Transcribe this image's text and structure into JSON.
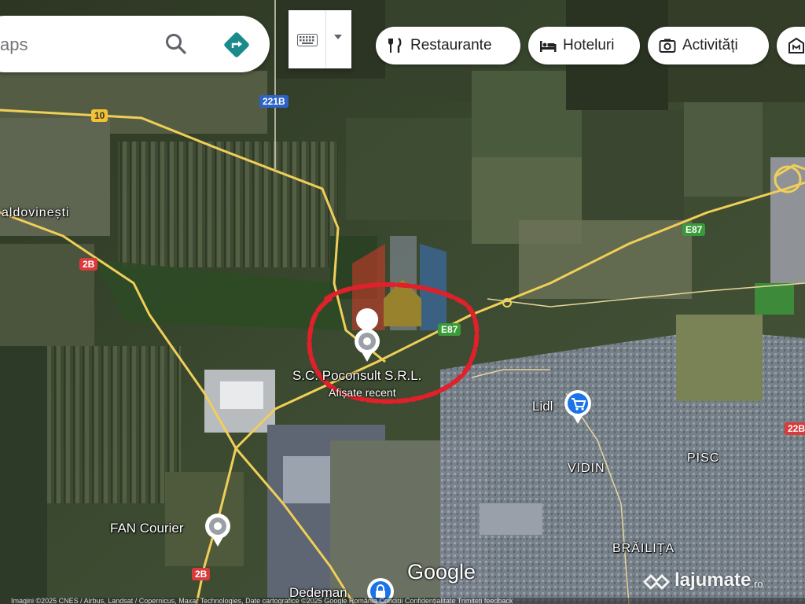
{
  "search": {
    "placeholder": "aps",
    "search_icon": "search-icon",
    "directions_icon": "directions-icon"
  },
  "input_tools": {
    "icon": "keyboard-icon",
    "arrow_icon": "dropdown-arrow-icon"
  },
  "chips": [
    {
      "label": "Restaurante",
      "icon": "fork-knife-icon"
    },
    {
      "label": "Hoteluri",
      "icon": "bed-icon"
    },
    {
      "label": "Activități",
      "icon": "camera-icon"
    },
    {
      "label": "",
      "icon": "museum-icon"
    }
  ],
  "places": {
    "baldovinesti": "aldovinești",
    "vidin": "VIDIN",
    "pisc": "PISC",
    "brailita": "BRĂILIȚA"
  },
  "pois": {
    "sc_poconsult": "S.C. Poconsult S.R.L.",
    "sc_poconsult_sub": "Afișate recent",
    "lidl": "Lidl",
    "fan_courier": "FAN Courier",
    "dedeman": "Dedeman"
  },
  "road_shields": {
    "r10": "10",
    "r221b": "221B",
    "r2b_a": "2B",
    "r2b_b": "2B",
    "e87_a": "E87",
    "e87_b": "E87",
    "r22b": "22B"
  },
  "branding": {
    "google": "Google",
    "watermark": "lajumate",
    "watermark_tld": ".ro"
  },
  "footer": "Imagini ©2025 CNES / Airbus, Landsat / Copernicus, Maxar Technologies, Date cartografice ©2025 Google   România   Condiții   Confidențialitate   Trimiteți feedback",
  "colors": {
    "highlight_circle": "#e0202a",
    "road_yellow": "#f0cf58",
    "poi_blue": "#1a73e8",
    "directions_teal": "#1a8a8a"
  }
}
